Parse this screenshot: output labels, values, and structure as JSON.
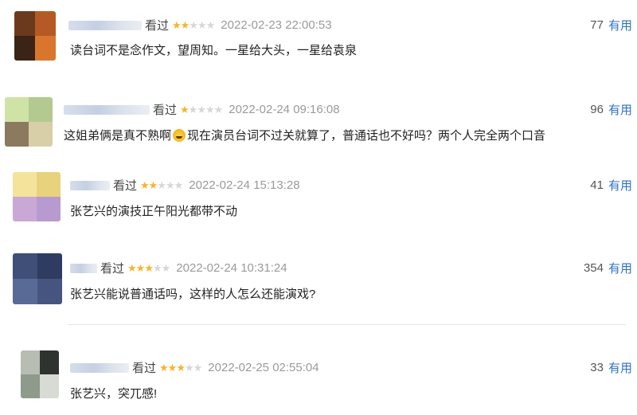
{
  "reviews": [
    {
      "status": "看过",
      "rating": 2,
      "time": "2022-02-23 22:00:53",
      "votes": "77",
      "useful_label": "有用",
      "text": "读台词不是念作文，望周知。一星给大头，一星给袁泉",
      "avatar_colors": [
        "#6b3a1c",
        "#b55a24",
        "#3b2415",
        "#d9762e"
      ]
    },
    {
      "status": "看过",
      "rating": 1,
      "time": "2022-02-24 09:16:08",
      "votes": "96",
      "useful_label": "有用",
      "text_before": "这姐弟俩是真不熟啊",
      "text_after": "现在演员台词不过关就算了，普通话也不好吗？两个人完全两个口音",
      "emoji_icon": "grinning-sweat-emoji",
      "avatar_colors": [
        "#cfe3a6",
        "#b3c98f",
        "#8c7a5e",
        "#d8cfa8"
      ]
    },
    {
      "status": "看过",
      "rating": 2,
      "time": "2022-02-24 15:13:28",
      "votes": "41",
      "useful_label": "有用",
      "text": "张艺兴的演技正午阳光都带不动",
      "avatar_colors": [
        "#f4e39a",
        "#e8d37c",
        "#c9a8d6",
        "#b79bd0"
      ]
    },
    {
      "status": "看过",
      "rating": 3,
      "time": "2022-02-24 10:31:24",
      "votes": "354",
      "useful_label": "有用",
      "text": "张艺兴能说普通话吗，这样的人怎么还能演戏?",
      "avatar_colors": [
        "#3f4f78",
        "#2e3c62",
        "#5a6a96",
        "#46557f"
      ]
    },
    {
      "status": "看过",
      "rating": 3,
      "time": "2022-02-25 02:55:04",
      "votes": "33",
      "useful_label": "有用",
      "text": "张艺兴，突兀感!",
      "avatar_colors": [
        "#b7bdb3",
        "#2f3330",
        "#8e9a8a",
        "#d7dbd4"
      ]
    }
  ]
}
